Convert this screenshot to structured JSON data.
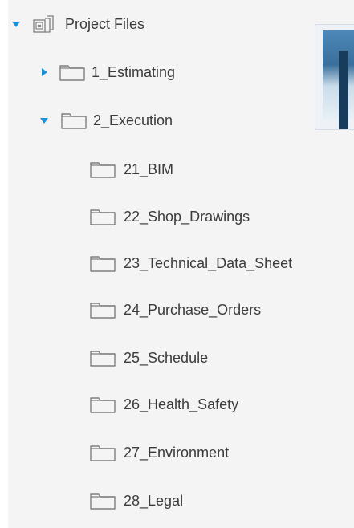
{
  "tree": {
    "root": {
      "label": "Project Files",
      "icon": "project-files-icon",
      "expanded": true
    },
    "folders": [
      {
        "label": "1_Estimating",
        "expanded": false
      },
      {
        "label": "2_Execution",
        "expanded": true,
        "children": [
          {
            "label": "21_BIM"
          },
          {
            "label": "22_Shop_Drawings"
          },
          {
            "label": "23_Technical_Data_Sheet"
          },
          {
            "label": "24_Purchase_Orders"
          },
          {
            "label": "25_Schedule"
          },
          {
            "label": "26_Health_Safety"
          },
          {
            "label": "27_Environment"
          },
          {
            "label": "28_Legal"
          }
        ]
      }
    ]
  },
  "colors": {
    "caret": "#1b91d6",
    "panel_bg": "#f4f4f4",
    "text": "#3c3c3c",
    "folder_stroke": "#7f7f7f"
  }
}
